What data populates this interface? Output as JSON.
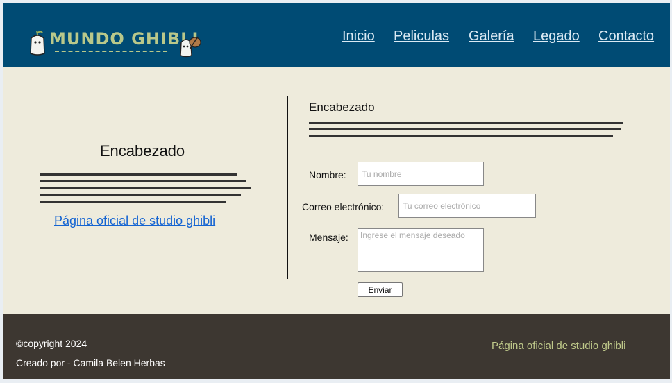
{
  "header": {
    "logo_text": "MUNDO GHIBLI",
    "nav": [
      "Inicio",
      "Peliculas",
      "Galería",
      "Legado",
      "Contacto"
    ]
  },
  "left_panel": {
    "heading": "Encabezado",
    "link": "Página oficial de studio ghibli"
  },
  "form": {
    "heading": "Encabezado",
    "name_label": "Nombre:",
    "name_placeholder": "Tu nombre",
    "email_label": "Correo electrónico:",
    "email_placeholder": "Tu correo electrónico",
    "message_label": "Mensaje:",
    "message_placeholder": "Ingrese el mensaje deseado",
    "submit_label": "Enviar"
  },
  "footer": {
    "copyright": "©copyright 2024",
    "credit": "Creado por - Camila Belen Herbas",
    "link": "Página oficial de studio ghibli"
  },
  "colors": {
    "header_bg": "#004b74",
    "main_bg": "#eeebdc",
    "footer_bg": "#3d3731",
    "logo": "#b9c88a",
    "link": "#1464d2"
  },
  "icons": [
    "kodama-spirit-icon",
    "bindle-spirit-icon"
  ]
}
